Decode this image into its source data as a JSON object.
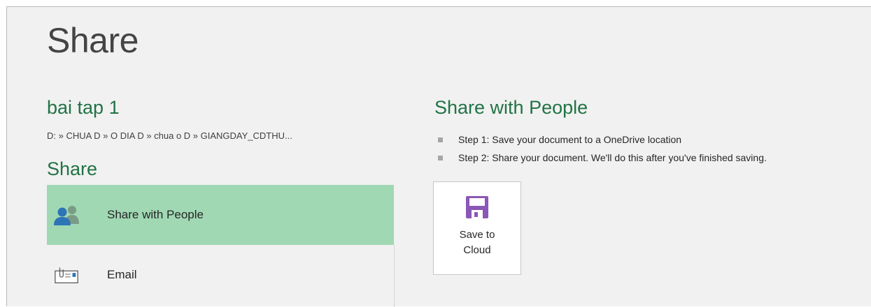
{
  "page": {
    "title": "Share"
  },
  "document": {
    "name": "bai tap 1",
    "path": "D: » CHUA D » O DIA D » chua o D » GIANGDAY_CDTHU..."
  },
  "share_section": {
    "heading": "Share",
    "items": [
      {
        "label": "Share with People",
        "icon": "people-icon",
        "selected": true
      },
      {
        "label": "Email",
        "icon": "email-icon",
        "selected": false
      }
    ]
  },
  "share_with_people": {
    "heading": "Share with People",
    "steps": [
      "Step 1: Save your document to a OneDrive location",
      "Step 2: Share your document. We'll do this after you've finished saving."
    ],
    "save_button": {
      "line1": "Save to",
      "line2": "Cloud",
      "icon": "save-disk-icon"
    }
  },
  "colors": {
    "accent_green": "#217346",
    "selected_bg": "#a0d8b4",
    "save_icon": "#8b57b6"
  }
}
